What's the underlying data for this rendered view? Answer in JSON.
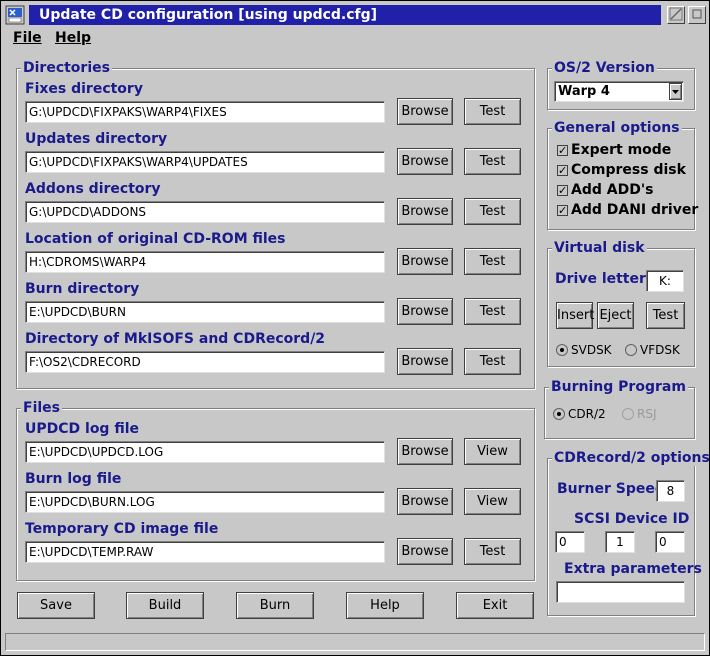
{
  "window": {
    "title": "Update CD configuration [using updcd.cfg]"
  },
  "menu": {
    "file": "File",
    "help": "Help"
  },
  "directories": {
    "title": "Directories",
    "rows": [
      {
        "label": "Fixes directory",
        "value": "G:\\UPDCD\\FIXPAKS\\WARP4\\FIXES",
        "browse": "Browse",
        "action": "Test"
      },
      {
        "label": "Updates directory",
        "value": "G:\\UPDCD\\FIXPAKS\\WARP4\\UPDATES",
        "browse": "Browse",
        "action": "Test"
      },
      {
        "label": "Addons directory",
        "value": "G:\\UPDCD\\ADDONS",
        "browse": "Browse",
        "action": "Test"
      },
      {
        "label": "Location of original CD-ROM files",
        "value": "H:\\CDROMS\\WARP4",
        "browse": "Browse",
        "action": "Test"
      },
      {
        "label": "Burn directory",
        "value": "E:\\UPDCD\\BURN",
        "browse": "Browse",
        "action": "Test"
      },
      {
        "label": "Directory of MkISOFS and CDRecord/2",
        "value": "F:\\OS2\\CDRECORD",
        "browse": "Browse",
        "action": "Test"
      }
    ]
  },
  "files": {
    "title": "Files",
    "rows": [
      {
        "label": "UPDCD log file",
        "value": "E:\\UPDCD\\UPDCD.LOG",
        "browse": "Browse",
        "action": "View"
      },
      {
        "label": "Burn log file",
        "value": "E:\\UPDCD\\BURN.LOG",
        "browse": "Browse",
        "action": "View"
      },
      {
        "label": "Temporary CD image file",
        "value": "E:\\UPDCD\\TEMP.RAW",
        "browse": "Browse",
        "action": "Test"
      }
    ]
  },
  "bottom_buttons": {
    "save": "Save",
    "build": "Build",
    "burn": "Burn",
    "help": "Help",
    "exit": "Exit"
  },
  "os2_version": {
    "title": "OS/2 Version",
    "selected": "Warp 4"
  },
  "general_options": {
    "title": "General options",
    "items": [
      {
        "label": "Expert mode",
        "checked": true
      },
      {
        "label": "Compress disk",
        "checked": true
      },
      {
        "label": "Add ADD's",
        "checked": true
      },
      {
        "label": "Add DANI driver",
        "checked": true
      }
    ],
    "check_mark": "✓"
  },
  "virtual_disk": {
    "title": "Virtual disk",
    "drive_letter_label": "Drive letter",
    "drive_letter": "K:",
    "insert": "Insert",
    "eject": "Eject",
    "test": "Test",
    "radio_svdsk": "SVDSK",
    "radio_vfdsk": "VFDSK",
    "selected": "SVDSK"
  },
  "burning_program": {
    "title": "Burning Program",
    "cdr2": "CDR/2",
    "rsj": "RSJ",
    "selected": "CDR/2"
  },
  "cdrecord_options": {
    "title": "CDRecord/2 options",
    "burner_speed_label": "Burner Speed",
    "burner_speed": "8",
    "scsi_label": "SCSI Device ID",
    "scsi_ids": [
      "0",
      "1",
      "0"
    ],
    "extra_label": "Extra parameters",
    "extra_value": ""
  },
  "icons": {
    "system_menu": "system-menu-icon",
    "minimize": "minimize-icon",
    "maximize": "maximize-icon",
    "dropdown": "chevron-down-icon"
  },
  "colors": {
    "title_bar": "#2020a8",
    "label_text": "#1a1a8c",
    "window_bg": "#c8c8c8"
  }
}
